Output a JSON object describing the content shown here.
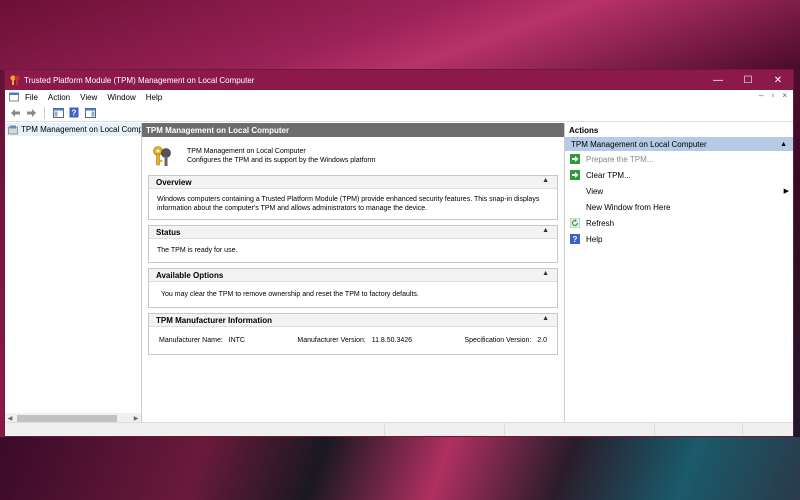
{
  "window": {
    "title": "Trusted Platform Module (TPM) Management on Local Computer",
    "minimize": "—",
    "maximize": "☐",
    "close": "✕"
  },
  "menu": {
    "items": [
      "File",
      "Action",
      "View",
      "Window",
      "Help"
    ],
    "right_controls": [
      "–",
      "▫",
      "×"
    ]
  },
  "tree": {
    "item_label": "TPM Management on Local Comp"
  },
  "center": {
    "header": "TPM Management on Local Computer",
    "intro_title": "TPM Management on Local Computer",
    "intro_desc": "Configures the TPM and its support by the Windows platform",
    "overview": {
      "title": "Overview",
      "line1": "Windows computers containing a Trusted Platform Module (TPM) provide enhanced security features. This snap-in displays",
      "line2": "information about the computer's TPM and allows administrators to manage the device."
    },
    "status": {
      "title": "Status",
      "text": "The TPM is ready for use."
    },
    "available_options": {
      "title": "Available Options",
      "text": "You may clear the TPM to remove ownership and reset the TPM to factory defaults."
    },
    "manufacturer": {
      "title": "TPM Manufacturer Information",
      "name_label": "Manufacturer Name:",
      "name_value": "INTC",
      "version_label": "Manufacturer Version:",
      "version_value": "11.8.50.3426",
      "spec_label": "Specification Version:",
      "spec_value": "2.0"
    },
    "collapse_glyph": "▲"
  },
  "actions": {
    "title": "Actions",
    "group": "TPM Management on Local Computer",
    "items": {
      "prepare": "Prepare the TPM...",
      "clear": "Clear TPM...",
      "view": "View",
      "new_window": "New Window from Here",
      "refresh": "Refresh",
      "help": "Help"
    },
    "submenu_arrow": "▶"
  },
  "colors": {
    "titlebar": "#8b1a4b",
    "center_header": "#6d6d6d",
    "actions_group": "#b5cbe5",
    "action_icon_green": "#2e9b3a",
    "help_icon_blue": "#3a62c9"
  }
}
